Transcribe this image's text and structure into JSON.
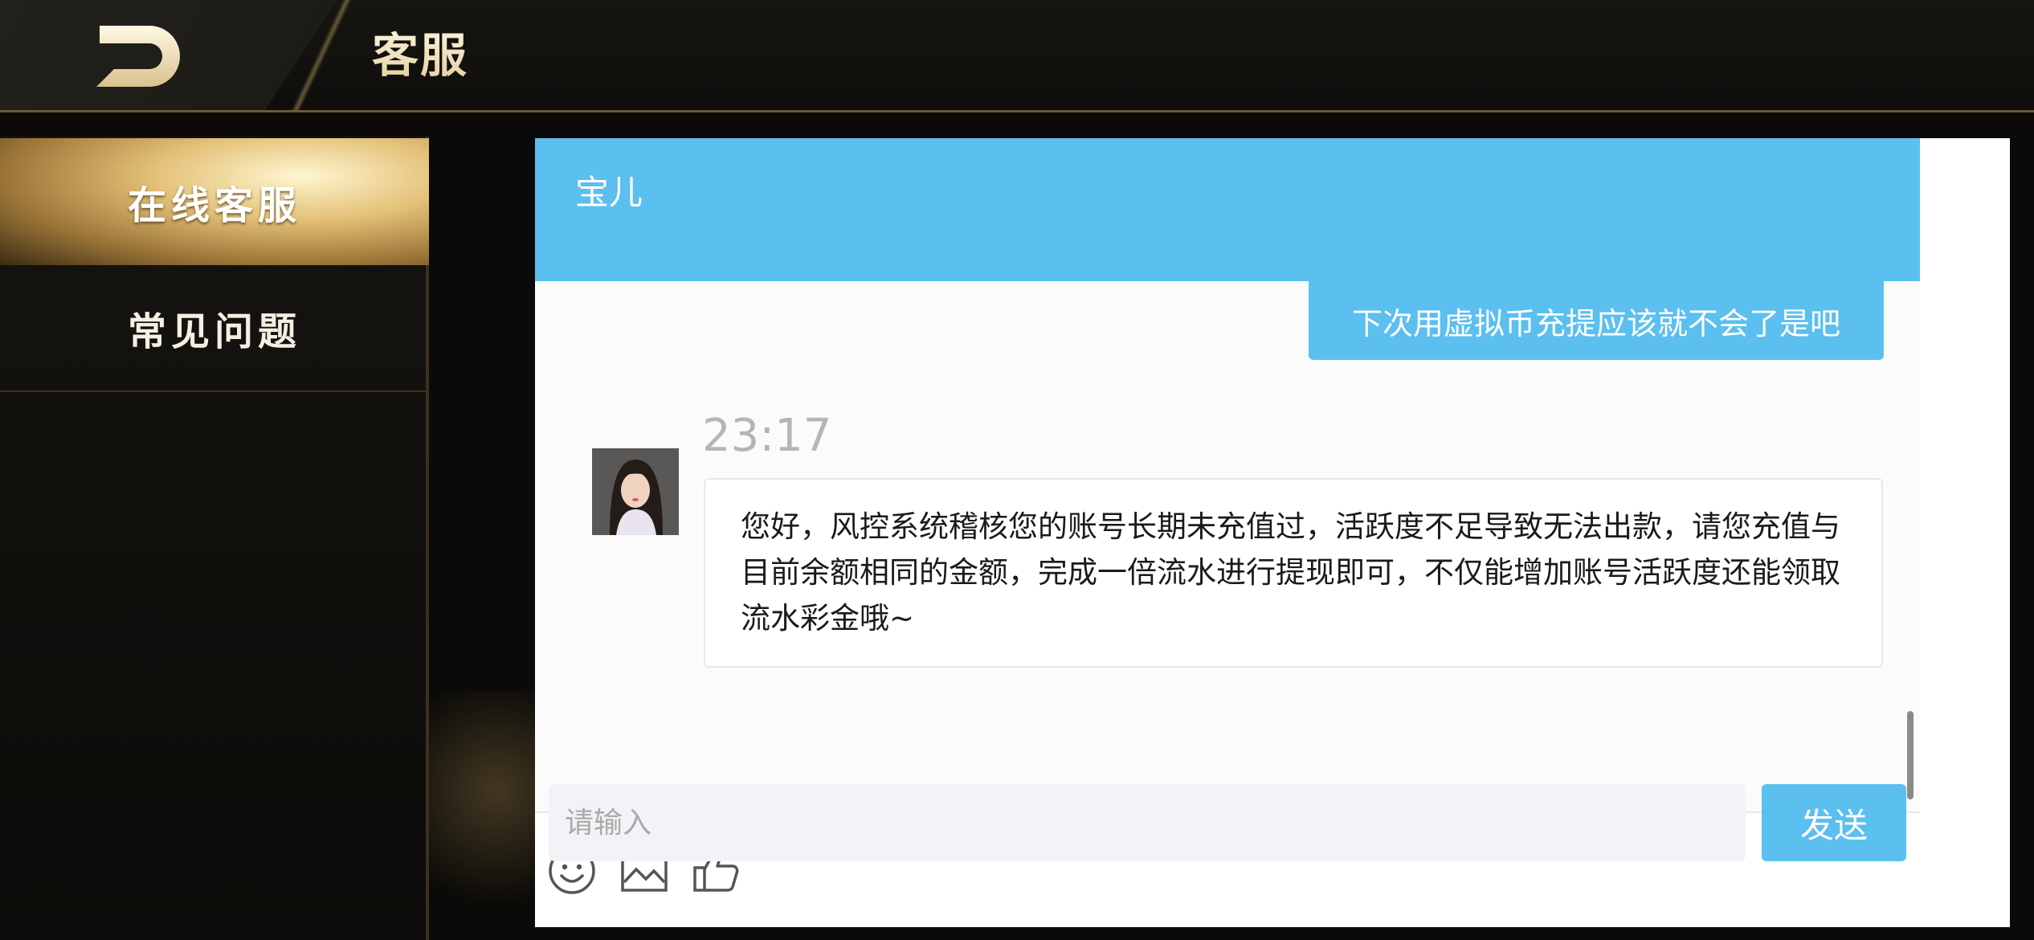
{
  "header": {
    "title": "客服"
  },
  "sidebar": {
    "items": [
      {
        "label": "在线客服",
        "active": true
      },
      {
        "label": "常见问题",
        "active": false
      }
    ]
  },
  "chat": {
    "agent_name": "宝儿",
    "messages": [
      {
        "direction": "outgoing",
        "text": "下次用虚拟币充提应该就不会了是吧"
      },
      {
        "direction": "incoming",
        "time": "23:17",
        "text": "您好，风控系统稽核您的账号长期未充值过，活跃度不足导致无法出款，请您充值与目前余额相同的金额，完成一倍流水进行提现即可，不仅能增加账号活跃度还能领取流水彩金哦~"
      }
    ],
    "toolbar": {
      "icons": [
        "emoji-icon",
        "image-icon",
        "thumbs-up-icon"
      ]
    },
    "input": {
      "placeholder": "请输入",
      "value": ""
    },
    "send_label": "发送"
  },
  "colors": {
    "accent": "#5bbff0",
    "gold": "#e3c076",
    "background": "#0b0a08"
  }
}
